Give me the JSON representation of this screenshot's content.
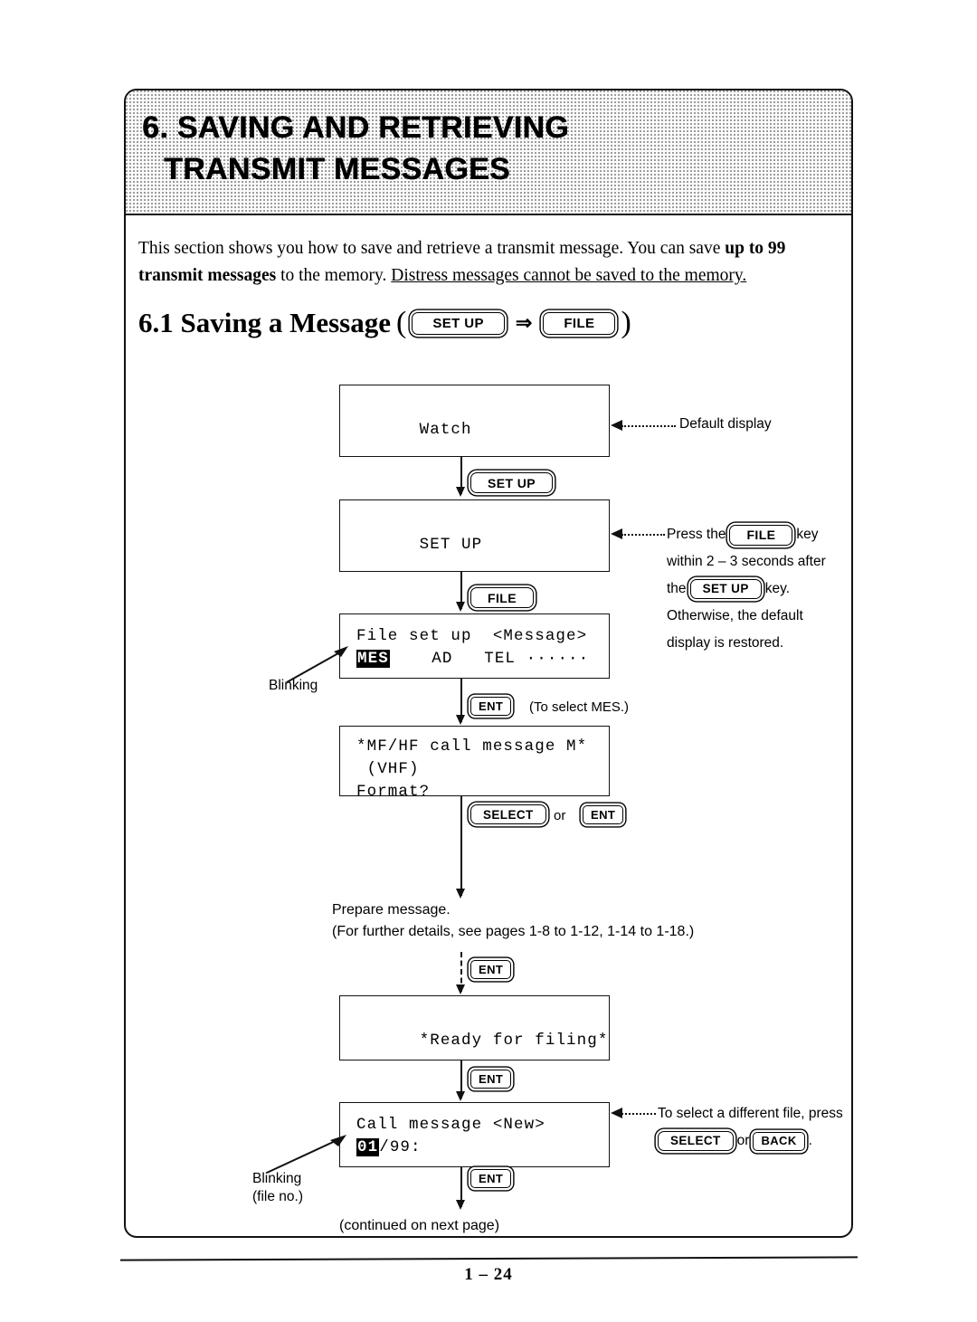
{
  "header": {
    "chapter_title_line1": "6. SAVING AND RETRIEVING",
    "chapter_title_line2": "TRANSMIT MESSAGES"
  },
  "intro": {
    "part1": "This section shows you how to save and retrieve a transmit message.  You can save ",
    "bold1": "up to 99 transmit messages",
    "part2": " to the memory. ",
    "underlined": "Distress messages cannot be saved to the memory."
  },
  "section": {
    "number_title": "6.1 Saving a Message",
    "open_paren": "(",
    "key_setup": "SET UP",
    "arrow": "⇒",
    "key_file": "FILE",
    "close_paren": ")"
  },
  "flow": {
    "box1": {
      "line1": "Watch"
    },
    "key1": "SET UP",
    "box2": {
      "line1": "SET UP"
    },
    "key2": "FILE",
    "box3": {
      "line1": "File set up  <Message>",
      "inverse": "MES",
      "line2_rest": "    AD   TEL ······"
    },
    "key3": "ENT",
    "key3_note": "(To select MES.)",
    "box4": {
      "line1": "*MF/HF call message M*",
      "line2": " (VHF)",
      "line3": "Format?"
    },
    "key4a": "SELECT",
    "key4_or": "or",
    "key4b": "ENT",
    "prepare_text": "Prepare message.\n(For further details, see pages 1-8 to 1-12, 1-14 to 1-18.)",
    "key5": "ENT",
    "box5": {
      "line1": "*Ready for filing*"
    },
    "key6": "ENT",
    "box6": {
      "line1": "Call message <New>",
      "inverse": "01",
      "line2_rest": "/99:"
    },
    "key7": "ENT",
    "continued_text": "(continued on next page)"
  },
  "annotations": {
    "default_display": "Default display",
    "file_note": {
      "t1": "Press the",
      "key_file": "FILE",
      "t2": "key",
      "t3": "within 2 – 3 seconds after",
      "t4": "the",
      "key_setup": "SET UP",
      "t5": "key.",
      "t6": "Otherwise, the default",
      "t7": "display is restored."
    },
    "select_file_note": {
      "t1": "To select a different file, press",
      "key_select": "SELECT",
      "or": "or",
      "key_back": "BACK",
      "period": "."
    },
    "blinking_1": "Blinking",
    "blinking_2": "Blinking\n(file no.)"
  },
  "footer": {
    "page_number": "1 – 24"
  }
}
